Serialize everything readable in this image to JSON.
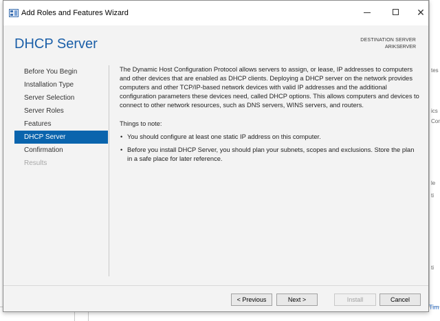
{
  "window": {
    "title": "Add Roles and Features Wizard"
  },
  "header": {
    "page_title": "DHCP Server",
    "destination_label": "DESTINATION SERVER",
    "destination_server": "ARIKSERVER"
  },
  "nav": {
    "items": [
      {
        "label": "Before You Begin",
        "state": "normal"
      },
      {
        "label": "Installation Type",
        "state": "normal"
      },
      {
        "label": "Server Selection",
        "state": "normal"
      },
      {
        "label": "Server Roles",
        "state": "normal"
      },
      {
        "label": "Features",
        "state": "normal"
      },
      {
        "label": "DHCP Server",
        "state": "active"
      },
      {
        "label": "Confirmation",
        "state": "normal"
      },
      {
        "label": "Results",
        "state": "disabled"
      }
    ]
  },
  "content": {
    "intro": "The Dynamic Host Configuration Protocol allows servers to assign, or lease, IP addresses to computers and other devices that are enabled as DHCP clients. Deploying a DHCP server on the network provides computers and other TCP/IP-based network devices with valid IP addresses and the additional configuration parameters these devices need, called DHCP options. This allows computers and devices to connect to other network resources, such as DNS servers, WINS servers, and routers.",
    "notes_heading": "Things to note:",
    "notes": [
      "You should configure at least one static IP address on this computer.",
      "Before you install DHCP Server, you should plan your subnets, scopes and exclusions. Store the plan in a safe place for later reference."
    ]
  },
  "buttons": {
    "previous": "< Previous",
    "next": "Next >",
    "install": "Install",
    "cancel": "Cancel"
  },
  "background": {
    "right_fragments": [
      "tes",
      "ics",
      "Cor",
      "le",
      "ti",
      "ti"
    ],
    "bottom_right": "Tim"
  },
  "colors": {
    "accent": "#0a64ad",
    "title_blue": "#1b5fa8"
  }
}
